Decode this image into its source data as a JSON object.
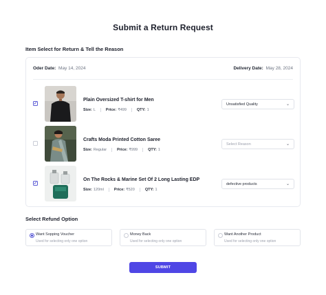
{
  "page": {
    "title": "Submit a Return Request"
  },
  "items_section": {
    "title": "Item Select for Return & Tell the Reason"
  },
  "order": {
    "order_date_label": "Oder Date:",
    "order_date_value": "May 14, 2024",
    "delivery_date_label": "Delivery Date:",
    "delivery_date_value": "May 28, 2024"
  },
  "meta_labels": {
    "size": "Size:",
    "price": "Price:",
    "qty": "QTY:"
  },
  "items": [
    {
      "name": "Plain Oversized T-shirt for Men",
      "size": "L",
      "price": "₹499",
      "qty": "1",
      "checked": true,
      "reason": "Unsatisfied Quality"
    },
    {
      "name": "Crafts Moda Printed Cotton Saree",
      "size": "Regular",
      "price": "₹999",
      "qty": "1",
      "checked": false,
      "reason_placeholder": "Select Reason"
    },
    {
      "name": "On The Rocks & Marine Set Of 2 Long Lasting EDP",
      "size": "120ml",
      "price": "₹520",
      "qty": "1",
      "checked": true,
      "reason": "defective products"
    }
  ],
  "check_mark": "✓",
  "chevron": "⌄",
  "refund_section": {
    "title": "Select Refund Option"
  },
  "refund_options": [
    {
      "label": "Want Sopping Voucher",
      "sub": "Used for selecting only one option",
      "selected": true
    },
    {
      "label": "Money Back",
      "sub": "Used for selecting only one option",
      "selected": false
    },
    {
      "label": "Want Another Product",
      "sub": "Used for selecting only one option",
      "selected": false
    }
  ],
  "submit": {
    "label": "SUBMIT"
  },
  "colors": {
    "accent": "#4f46e5",
    "border": "#e7e9ef",
    "muted": "#6b7280"
  }
}
